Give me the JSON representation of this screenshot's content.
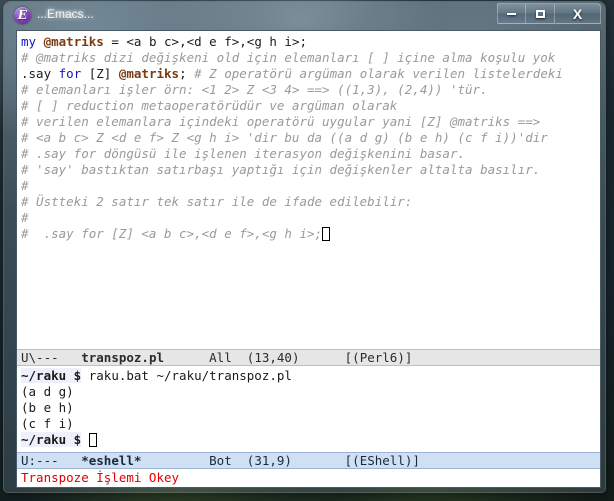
{
  "window": {
    "title": "...Emacs...",
    "icon": "emacs-icon",
    "icon_glyph": "E",
    "controls": {
      "minimize_label": "Minimize",
      "maximize_label": "Maximize",
      "close_label": "X"
    }
  },
  "code_buffer": {
    "name": "transpoz.pl",
    "lines": [
      [
        {
          "t": "my",
          "c": "kw"
        },
        {
          "t": " ",
          "c": "plain"
        },
        {
          "t": "@matriks",
          "c": "var"
        },
        {
          "t": " = <a b c>,<d e f>,<g h i>;",
          "c": "plain"
        }
      ],
      [
        {
          "t": "# @matriks dizi değişkeni old için elemanları [ ] içine alma koşulu yok",
          "c": "cmt"
        }
      ],
      [
        {
          "t": ".say",
          "c": "plain"
        },
        {
          "t": " ",
          "c": "plain"
        },
        {
          "t": "for",
          "c": "kw"
        },
        {
          "t": " [Z] ",
          "c": "plain"
        },
        {
          "t": "@matriks",
          "c": "var"
        },
        {
          "t": ";",
          "c": "plain"
        },
        {
          "t": " # Z operatörü argüman olarak verilen listelerdeki",
          "c": "cmt"
        }
      ],
      [
        {
          "t": "# elemanları işler örn: <1 2> Z <3 4> ==> ((1,3), (2,4)) 'tür.",
          "c": "cmt"
        }
      ],
      [
        {
          "t": "# [ ] reduction metaoperatörüdür ve argüman olarak",
          "c": "cmt"
        }
      ],
      [
        {
          "t": "# verilen elemanlara içindeki operatörü uygular yani [Z] @matriks ==>",
          "c": "cmt"
        }
      ],
      [
        {
          "t": "# <a b c> Z <d e f> Z <g h i> 'dir bu da ((a d g) (b e h) (c f i))'dir",
          "c": "cmt"
        }
      ],
      [
        {
          "t": "# .say for döngüsü ile işlenen iterasyon değişkenini basar.",
          "c": "cmt"
        }
      ],
      [
        {
          "t": "# 'say' bastıktan satırbaşı yaptığı için değişkenler altalta basılır.",
          "c": "cmt"
        }
      ],
      [
        {
          "t": "#",
          "c": "cmt"
        }
      ],
      [
        {
          "t": "# Üstteki 2 satır tek satır ile de ifade edilebilir:",
          "c": "cmt"
        }
      ],
      [
        {
          "t": "#",
          "c": "cmt"
        }
      ],
      [
        {
          "t": "#  .say for [Z] <a b c>,<d e f>,<g h i>;",
          "c": "cmt"
        },
        {
          "t": "",
          "c": "cursor"
        }
      ]
    ]
  },
  "modeline_top": {
    "flags": "U\\---",
    "buffer": "transpoz.pl",
    "position": "All",
    "coords": "(13,40)",
    "major_mode": "[(Perl6)]"
  },
  "eshell_buffer": {
    "name": "*eshell*",
    "lines": [
      {
        "prompt": "~/raku $",
        "text": " raku.bat ~/raku/transpoz.pl"
      },
      {
        "prompt": "",
        "text": "(a d g)"
      },
      {
        "prompt": "",
        "text": "(b e h)"
      },
      {
        "prompt": "",
        "text": "(c f i)"
      },
      {
        "prompt": "~/raku $",
        "text": " ",
        "cursor": true
      }
    ]
  },
  "modeline_bottom": {
    "flags": "U:---",
    "buffer": "*eshell*",
    "position": "Bot",
    "coords": "(31,9)",
    "major_mode": "[(EShell)]"
  },
  "echo_area": {
    "message": "Transpoze İşlemi Okey",
    "color": "#e00000"
  }
}
